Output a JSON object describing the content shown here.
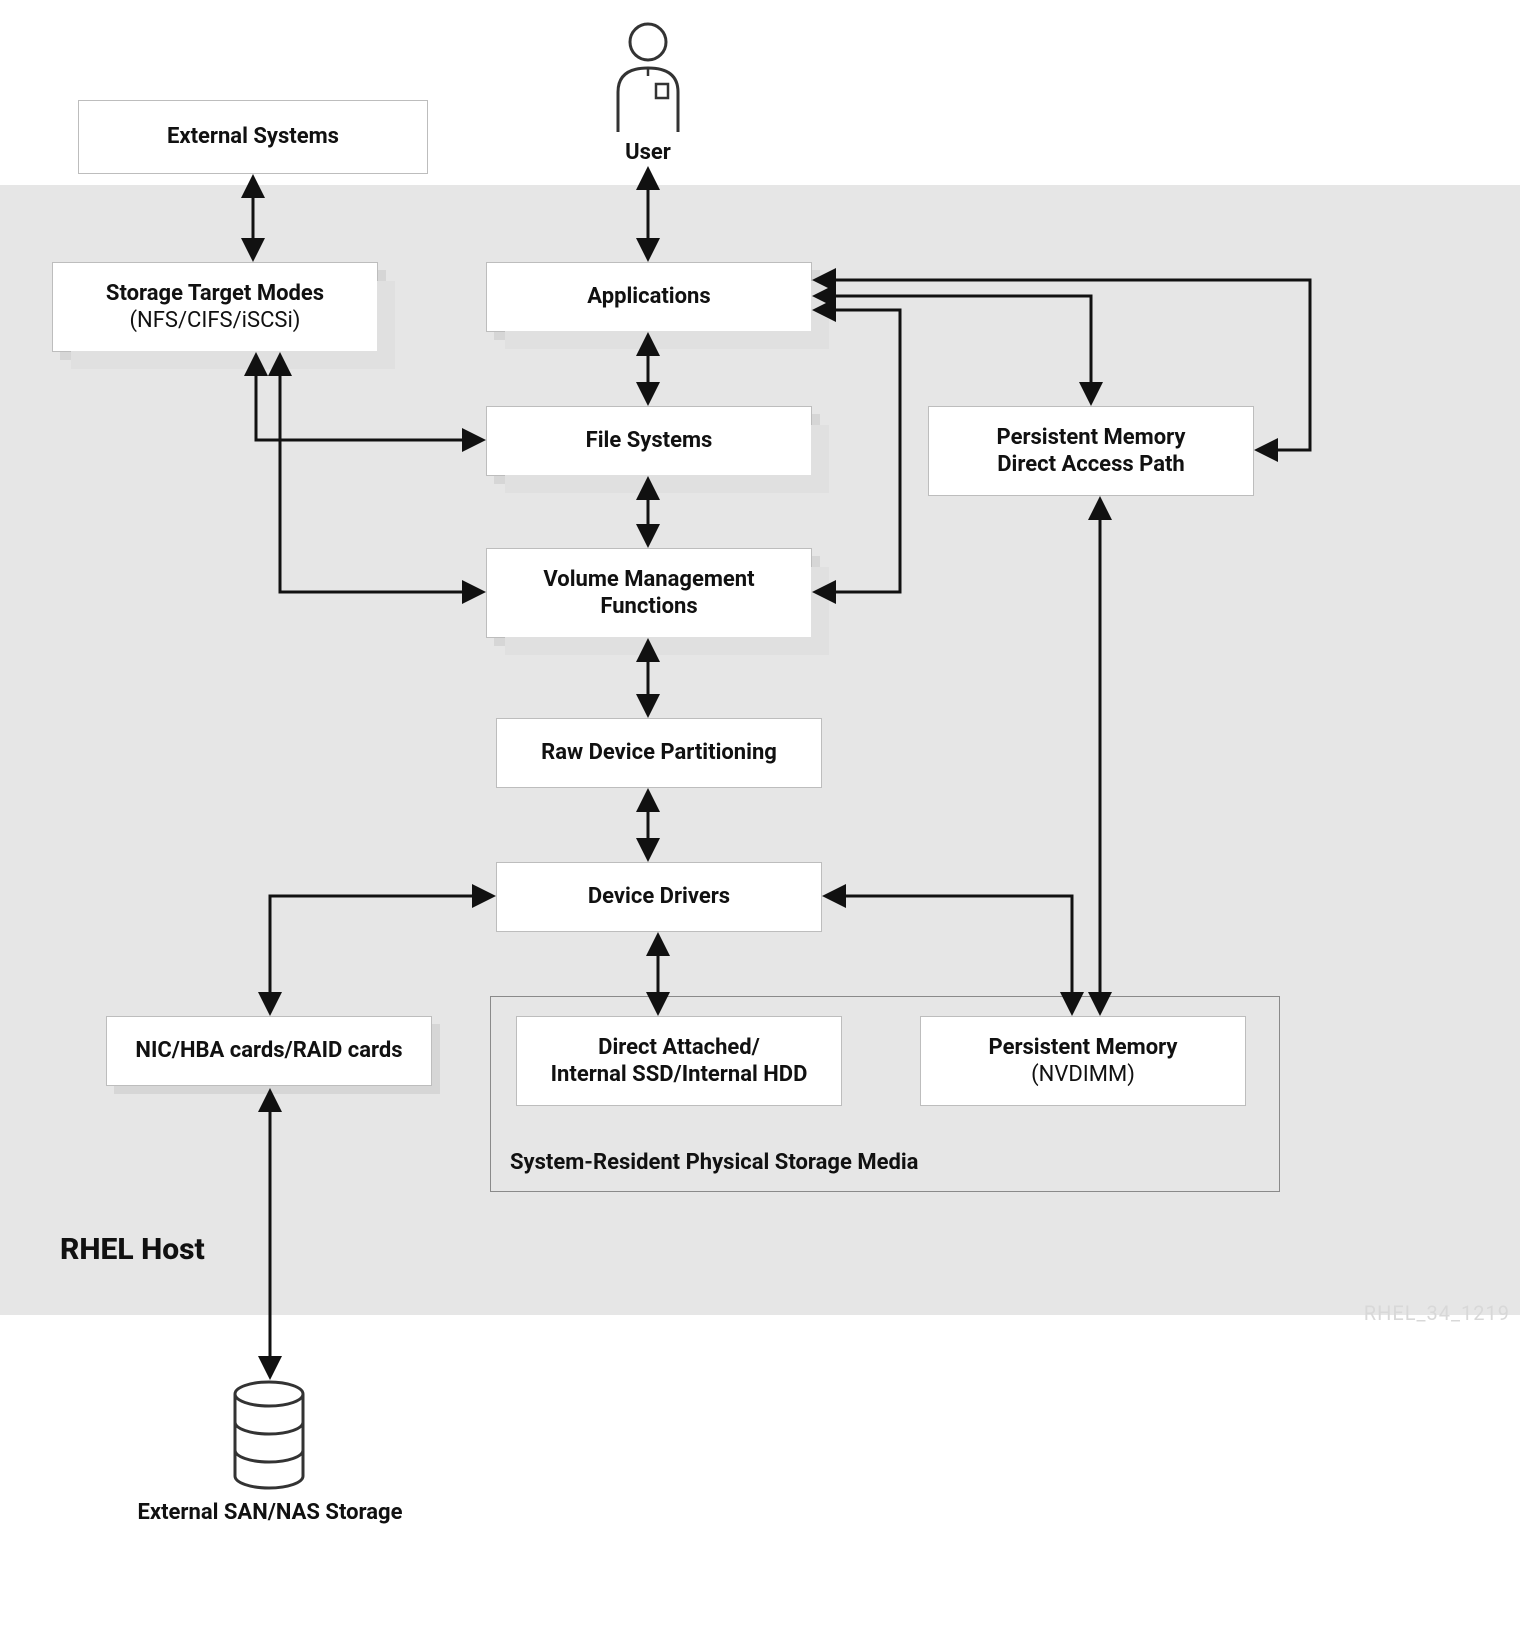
{
  "diagram": {
    "external_systems": {
      "title": "External Systems"
    },
    "user": {
      "label": "User"
    },
    "storage_target_modes": {
      "title": "Storage Target Modes",
      "sub": "(NFS/CIFS/iSCSi)"
    },
    "applications": {
      "title": "Applications"
    },
    "file_systems": {
      "title": "File Systems"
    },
    "volume_mgmt": {
      "title": "Volume Management",
      "sub": "Functions"
    },
    "raw_partitioning": {
      "title": "Raw Device Partitioning"
    },
    "device_drivers": {
      "title": "Device Drivers"
    },
    "persistent_mem_path": {
      "title": "Persistent Memory",
      "sub": "Direct Access Path"
    },
    "nic_hba": {
      "title": "NIC/HBA cards/RAID cards"
    },
    "direct_attached": {
      "title": "Direct Attached/",
      "sub": "Internal SSD/Internal HDD"
    },
    "persistent_mem_nvdimm": {
      "title": "Persistent Memory",
      "sub": "(NVDIMM)"
    },
    "storage_media_frame": {
      "label": "System-Resident Physical Storage Media"
    },
    "rhel_host": {
      "label": "RHEL Host"
    },
    "external_san": {
      "label": "External SAN/NAS Storage"
    },
    "corner_code": "RHEL_34_1219"
  }
}
